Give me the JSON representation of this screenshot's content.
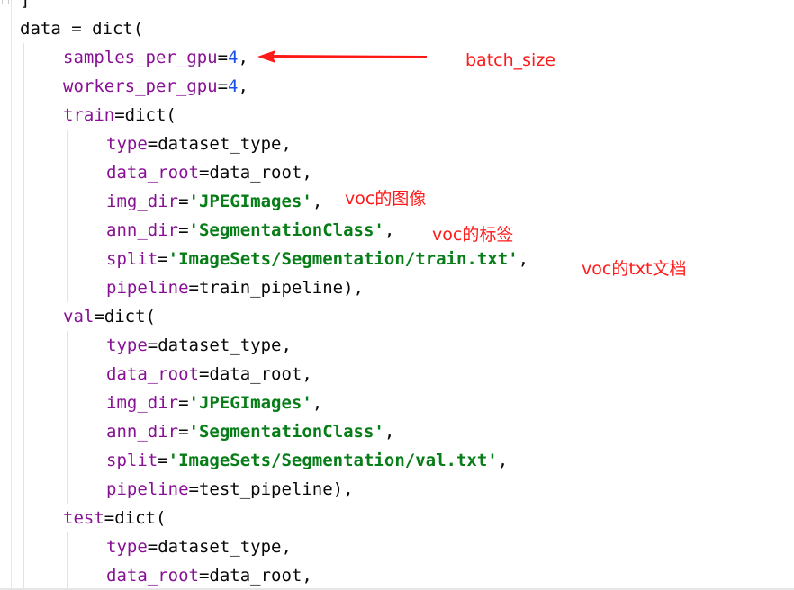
{
  "editor": {
    "lines": [
      {
        "indent": 0,
        "tokens": [
          {
            "t": "plain",
            "v": "]"
          }
        ]
      },
      {
        "indent": 0,
        "tokens": [
          {
            "t": "plain",
            "v": "data = dict("
          }
        ]
      },
      {
        "indent": 1,
        "tokens": [
          {
            "t": "kw",
            "v": "samples_per_gpu"
          },
          {
            "t": "plain",
            "v": "="
          },
          {
            "t": "num",
            "v": "4"
          },
          {
            "t": "plain",
            "v": ","
          }
        ]
      },
      {
        "indent": 1,
        "tokens": [
          {
            "t": "kw",
            "v": "workers_per_gpu"
          },
          {
            "t": "plain",
            "v": "="
          },
          {
            "t": "num",
            "v": "4"
          },
          {
            "t": "plain",
            "v": ","
          }
        ]
      },
      {
        "indent": 1,
        "tokens": [
          {
            "t": "kw",
            "v": "train"
          },
          {
            "t": "plain",
            "v": "=dict("
          }
        ]
      },
      {
        "indent": 2,
        "tokens": [
          {
            "t": "kw",
            "v": "type"
          },
          {
            "t": "plain",
            "v": "=dataset_type,"
          }
        ]
      },
      {
        "indent": 2,
        "tokens": [
          {
            "t": "kw",
            "v": "data_root"
          },
          {
            "t": "plain",
            "v": "=data_root,"
          }
        ]
      },
      {
        "indent": 2,
        "tokens": [
          {
            "t": "kw",
            "v": "img_dir"
          },
          {
            "t": "plain",
            "v": "="
          },
          {
            "t": "str",
            "v": "'JPEGImages'"
          },
          {
            "t": "plain",
            "v": ","
          }
        ]
      },
      {
        "indent": 2,
        "tokens": [
          {
            "t": "kw",
            "v": "ann_dir"
          },
          {
            "t": "plain",
            "v": "="
          },
          {
            "t": "str",
            "v": "'SegmentationClass'"
          },
          {
            "t": "plain",
            "v": ","
          }
        ]
      },
      {
        "indent": 2,
        "tokens": [
          {
            "t": "kw",
            "v": "split"
          },
          {
            "t": "plain",
            "v": "="
          },
          {
            "t": "str",
            "v": "'ImageSets/Segmentation/train.txt'"
          },
          {
            "t": "plain",
            "v": ","
          }
        ]
      },
      {
        "indent": 2,
        "tokens": [
          {
            "t": "kw",
            "v": "pipeline"
          },
          {
            "t": "plain",
            "v": "=train_pipeline),"
          }
        ]
      },
      {
        "indent": 1,
        "tokens": [
          {
            "t": "kw",
            "v": "val"
          },
          {
            "t": "plain",
            "v": "=dict("
          }
        ]
      },
      {
        "indent": 2,
        "tokens": [
          {
            "t": "kw",
            "v": "type"
          },
          {
            "t": "plain",
            "v": "=dataset_type,"
          }
        ]
      },
      {
        "indent": 2,
        "tokens": [
          {
            "t": "kw",
            "v": "data_root"
          },
          {
            "t": "plain",
            "v": "=data_root,"
          }
        ]
      },
      {
        "indent": 2,
        "tokens": [
          {
            "t": "kw",
            "v": "img_dir"
          },
          {
            "t": "plain",
            "v": "="
          },
          {
            "t": "str",
            "v": "'JPEGImages'"
          },
          {
            "t": "plain",
            "v": ","
          }
        ]
      },
      {
        "indent": 2,
        "tokens": [
          {
            "t": "kw",
            "v": "ann_dir"
          },
          {
            "t": "plain",
            "v": "="
          },
          {
            "t": "str",
            "v": "'SegmentationClass'"
          },
          {
            "t": "plain",
            "v": ","
          }
        ]
      },
      {
        "indent": 2,
        "tokens": [
          {
            "t": "kw",
            "v": "split"
          },
          {
            "t": "plain",
            "v": "="
          },
          {
            "t": "str",
            "v": "'ImageSets/Segmentation/val.txt'"
          },
          {
            "t": "plain",
            "v": ","
          }
        ]
      },
      {
        "indent": 2,
        "tokens": [
          {
            "t": "kw",
            "v": "pipeline"
          },
          {
            "t": "plain",
            "v": "=test_pipeline),"
          }
        ]
      },
      {
        "indent": 1,
        "tokens": [
          {
            "t": "kw",
            "v": "test"
          },
          {
            "t": "plain",
            "v": "=dict("
          }
        ]
      },
      {
        "indent": 2,
        "tokens": [
          {
            "t": "kw",
            "v": "type"
          },
          {
            "t": "plain",
            "v": "=dataset_type,"
          }
        ]
      },
      {
        "indent": 2,
        "tokens": [
          {
            "t": "kw",
            "v": "data_root"
          },
          {
            "t": "plain",
            "v": "=data_root,"
          }
        ]
      }
    ]
  },
  "annotations": {
    "batch_size": "batch_size",
    "img_dir_note": "voc的图像",
    "ann_dir_note": "voc的标签",
    "split_note": "voc的txt文档"
  },
  "colors": {
    "keyword": "#871094",
    "number": "#1750eb",
    "string": "#067d17",
    "annotation": "#ff1a1a"
  }
}
